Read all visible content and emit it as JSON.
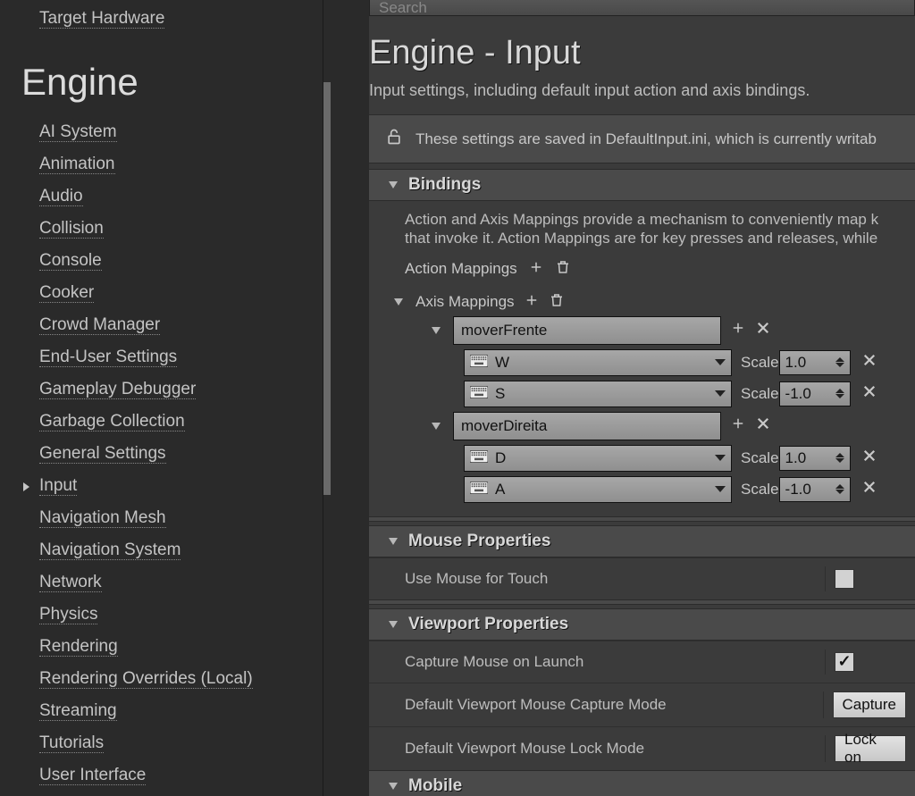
{
  "sidebar": {
    "top_item": "Target Hardware",
    "category": "Engine",
    "items": [
      "AI System",
      "Animation",
      "Audio",
      "Collision",
      "Console",
      "Cooker",
      "Crowd Manager",
      "End-User Settings",
      "Gameplay Debugger",
      "Garbage Collection",
      "General Settings",
      "Input",
      "Navigation Mesh",
      "Navigation System",
      "Network",
      "Physics",
      "Rendering",
      "Rendering Overrides (Local)",
      "Streaming",
      "Tutorials",
      "User Interface"
    ],
    "selected_index": 11
  },
  "search": {
    "placeholder": "Search"
  },
  "page": {
    "title": "Engine - Input",
    "description": "Input settings, including default input action and axis bindings.",
    "notice": "These settings are saved in DefaultInput.ini, which is currently writab"
  },
  "bindings": {
    "header": "Bindings",
    "blurb": "Action and Axis Mappings provide a mechanism to conveniently map k that invoke it. Action Mappings are for key presses and releases, while",
    "action_label": "Action Mappings",
    "axis_label": "Axis Mappings",
    "scale_word": "Scale",
    "axes": [
      {
        "name": "moverFrente",
        "keys": [
          {
            "key": "W",
            "scale": "1.0"
          },
          {
            "key": "S",
            "scale": "-1.0"
          }
        ]
      },
      {
        "name": "moverDireita",
        "keys": [
          {
            "key": "D",
            "scale": "1.0"
          },
          {
            "key": "A",
            "scale": "-1.0"
          }
        ]
      }
    ]
  },
  "mouse": {
    "header": "Mouse Properties",
    "use_for_touch": "Use Mouse for Touch",
    "use_for_touch_checked": false
  },
  "viewport": {
    "header": "Viewport Properties",
    "rows": [
      {
        "label": "Capture Mouse on Launch",
        "type": "check",
        "checked": true
      },
      {
        "label": "Default Viewport Mouse Capture Mode",
        "type": "combo",
        "value": "Capture"
      },
      {
        "label": "Default Viewport Mouse Lock Mode",
        "type": "combo",
        "value": "Lock on"
      }
    ]
  },
  "mobile": {
    "header": "Mobile"
  }
}
